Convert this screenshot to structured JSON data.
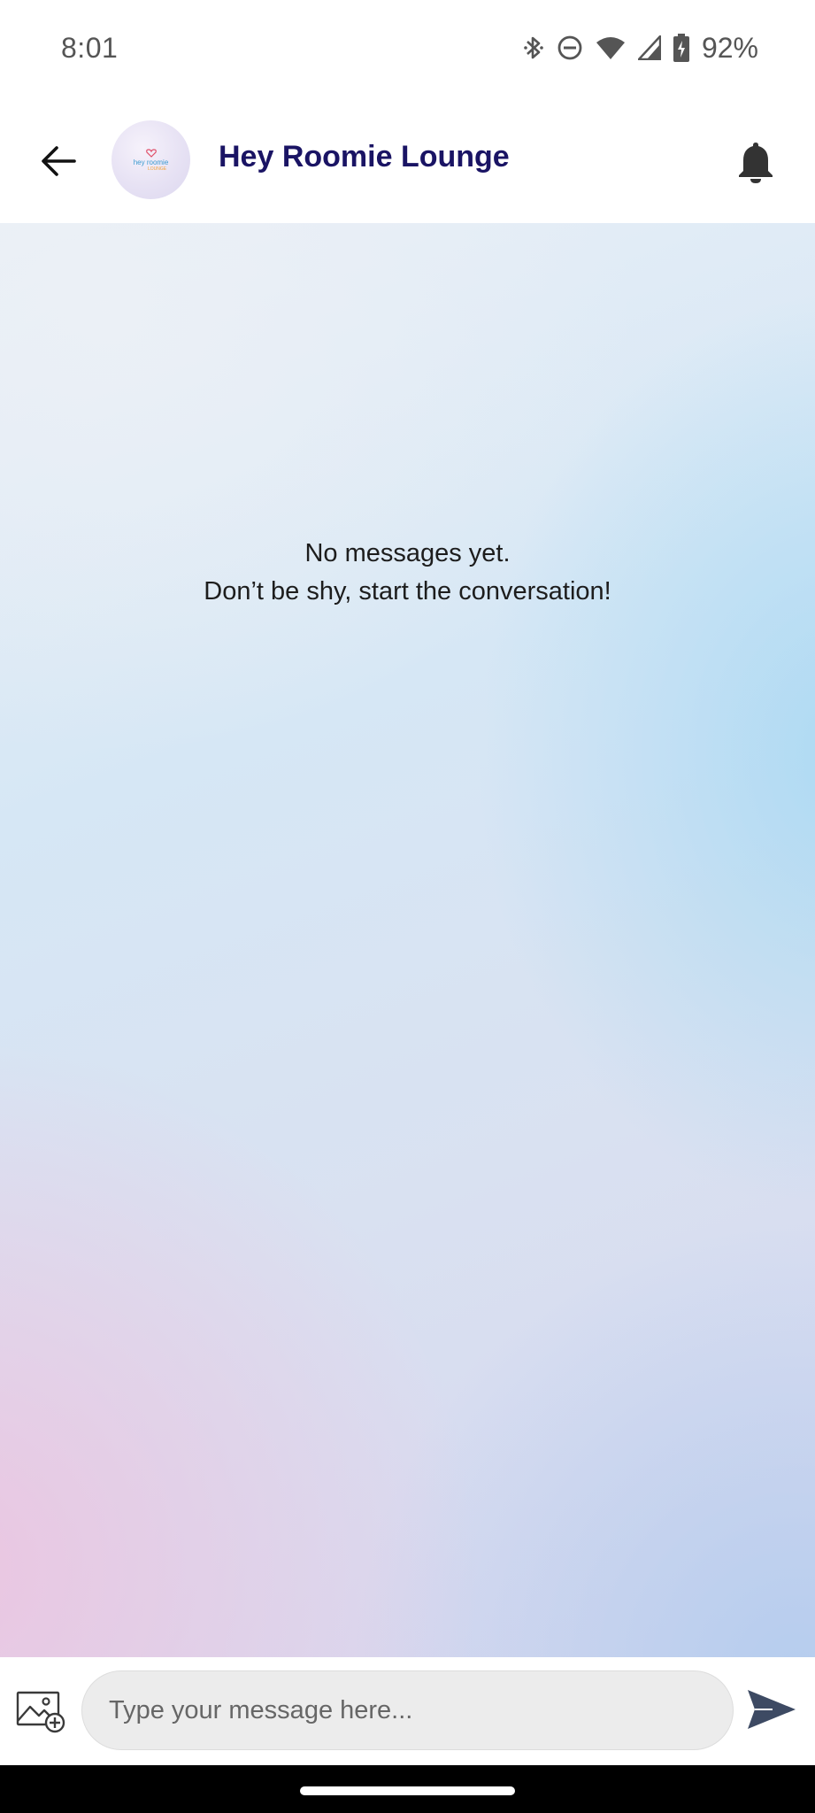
{
  "status_bar": {
    "time": "8:01",
    "battery_percent": "92%",
    "icons": [
      "bluetooth-icon",
      "do-not-disturb-icon",
      "wifi-icon",
      "cell-signal-icon",
      "battery-charging-icon"
    ]
  },
  "header": {
    "back_icon": "arrow-left-icon",
    "avatar_text": "hey roomie",
    "avatar_subtext": "LOUNGE",
    "title": "Hey Roomie Lounge",
    "bell_icon": "bell-icon"
  },
  "chat": {
    "empty_line_1": "No messages yet.",
    "empty_line_2": "Don’t be shy, start the conversation!"
  },
  "composer": {
    "attach_icon": "add-image-icon",
    "placeholder": "Type your message here...",
    "value": "",
    "send_icon": "send-icon"
  },
  "colors": {
    "title": "#1a1464",
    "icon_dark": "#333333",
    "input_bg": "#ececec"
  }
}
